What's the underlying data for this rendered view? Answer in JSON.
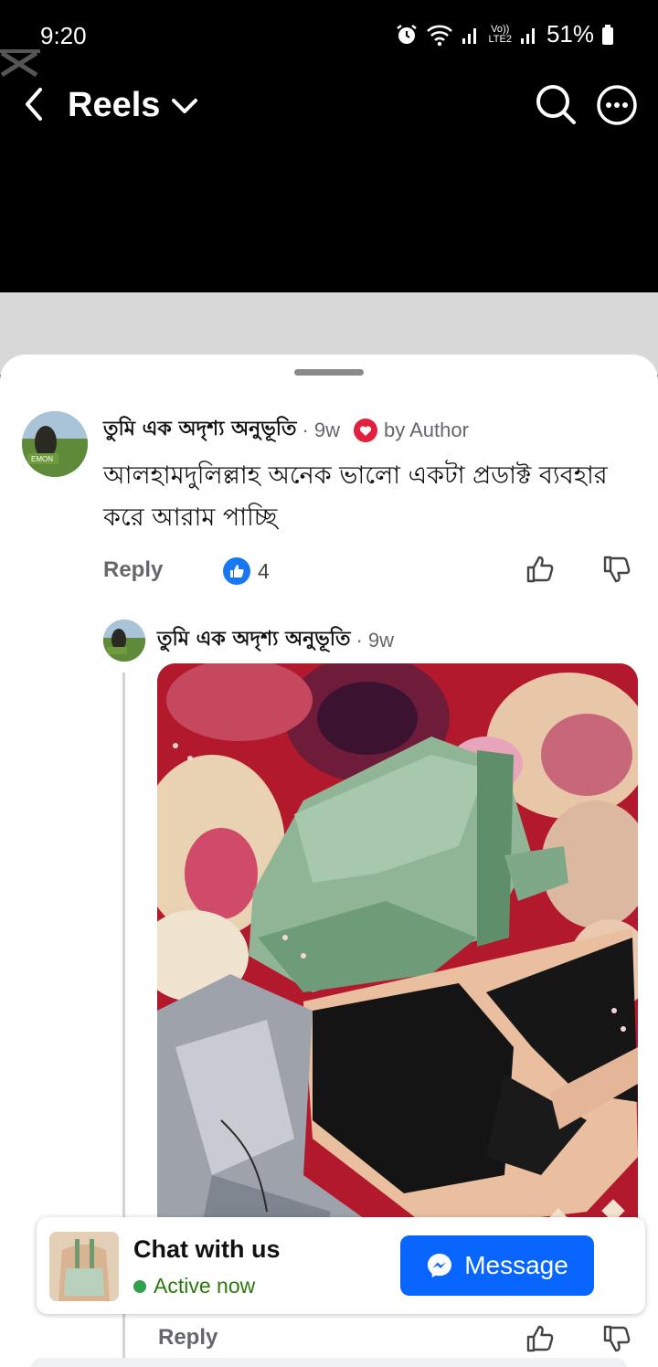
{
  "status_bar": {
    "time": "9:20",
    "battery": "51%",
    "network_label_top": "Vo))",
    "network_label_bottom": "LTE2"
  },
  "header": {
    "title": "Reels"
  },
  "comment": {
    "author": "তুমি এক অদৃশ্য অনুভূতি",
    "age": "9w",
    "badge": "by Author",
    "avatar_caption": "EMON",
    "text": "আলহামদুলিল্লাহ অনেক ভালো একটা প্রডাক্ট ব্যবহার করে আরাম পাচ্ছি",
    "reply_label": "Reply",
    "like_count": "4"
  },
  "reply": {
    "author": "তুমি এক অদৃশ্য অনুভূতি",
    "age": "9w",
    "reply_label": "Reply"
  },
  "chat_card": {
    "title": "Chat with us",
    "status": "Active now",
    "button_label": "Message"
  },
  "colors": {
    "accent": "#0866ff",
    "like": "#1877f2",
    "active": "#31a24c",
    "author_badge": "#e41e3f"
  }
}
